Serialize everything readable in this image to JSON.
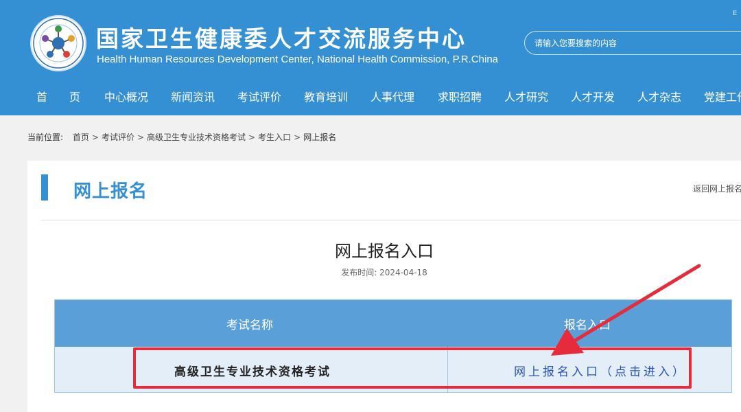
{
  "header": {
    "title": "国家卫生健康委人才交流服务中心",
    "subtitle": "Health Human Resources Development Center, National Health Commission, P.R.China",
    "top_fragment": "E",
    "search_placeholder": "请输入您要搜索的内容"
  },
  "nav": {
    "items": [
      "首页",
      "中心概况",
      "新闻资讯",
      "考试评价",
      "教育培训",
      "人事代理",
      "求职招聘",
      "人才研究",
      "人才开发",
      "人才杂志",
      "党建工作"
    ]
  },
  "breadcrumb": {
    "label": "当前位置:",
    "items": [
      "首页",
      "考试评价",
      "高级卫生专业技术资格考试",
      "考生入口",
      "网上报名"
    ]
  },
  "section": {
    "title": "网上报名",
    "back_link": "返回网上报名"
  },
  "article": {
    "title": "网上报名入口",
    "publish_label": "发布时间:",
    "publish_date": "2024-04-18"
  },
  "table": {
    "headers": [
      "考试名称",
      "报名入口"
    ],
    "rows": [
      {
        "name": "高级卫生专业技术资格考试",
        "link": "网上报名入口（点击进入）"
      }
    ]
  },
  "colors": {
    "header_blue": "#3590d3",
    "table_header": "#5b9fd8",
    "table_row": "#e3eef9",
    "link_blue": "#2b52b8",
    "annotation_red": "#e52b3c"
  }
}
